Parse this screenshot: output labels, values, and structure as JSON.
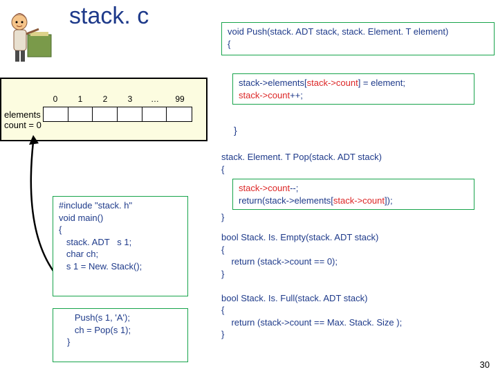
{
  "title": "stack. c",
  "indices": [
    "0",
    "1",
    "2",
    "3",
    "…",
    "99"
  ],
  "labels": {
    "elements": "elements",
    "count": "count = 0"
  },
  "main_code": "#include \"stack. h\"\nvoid main()\n{\n   stack. ADT   s 1;\n   char ch;\n   s 1 = New. Stack();",
  "push_call": "   Push(s 1, 'A');\n   ch = Pop(s 1);\n}",
  "push_def": "void Push(stack. ADT stack, stack. Element. T element)\n{",
  "push_body_line1": "stack->elements[",
  "push_body_line1b": "stack->count",
  "push_body_line1c": "] = element;",
  "push_body_line2": "stack->count",
  "push_body_line2b": "++;",
  "close_brace": "}",
  "pop_def": "stack. Element. T Pop(stack. ADT stack)\n{",
  "pop_body_line1": "stack->count",
  "pop_body_line1b": "--;",
  "pop_body_line2a": "return(stack->elements[",
  "pop_body_line2b": "stack->count",
  "pop_body_line2c": "]);",
  "pop_close": "}",
  "bool_fns": "bool Stack. Is. Empty(stack. ADT stack)\n{\n    return (stack->count == 0);\n}\n\nbool Stack. Is. Full(stack. ADT stack)\n{\n    return (stack->count == Max. Stack. Size );\n}",
  "pagenum": "30"
}
